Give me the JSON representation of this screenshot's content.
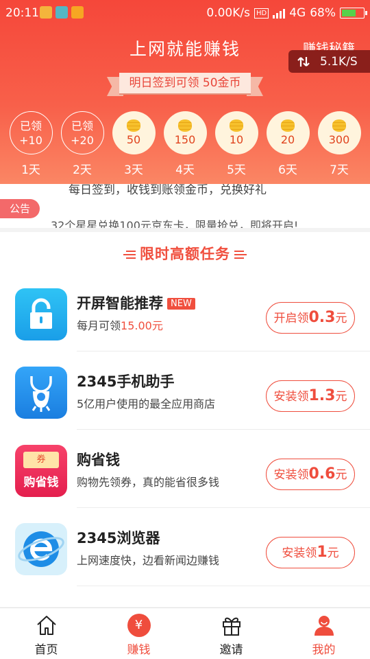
{
  "status_bar": {
    "time": "20:11",
    "network_speed": "0.00K/s",
    "hd": "HD",
    "network_type": "4G",
    "battery": "68%",
    "battery_level": 0.68
  },
  "header": {
    "title": "上网就能赚钱",
    "secret_link": "赚钱秘籍",
    "speed_widget": "5.1K/S"
  },
  "checkin": {
    "banner": "明日签到可领 50金币",
    "days": [
      {
        "state": "done",
        "status": "已领",
        "reward": "+10",
        "label": "1天"
      },
      {
        "state": "done",
        "status": "已领",
        "reward": "+20",
        "label": "2天"
      },
      {
        "state": "todo",
        "reward": "50",
        "label": "3天"
      },
      {
        "state": "todo",
        "reward": "150",
        "label": "4天"
      },
      {
        "state": "todo",
        "reward": "10",
        "label": "5天"
      },
      {
        "state": "todo",
        "reward": "20",
        "label": "6天"
      },
      {
        "state": "todo",
        "reward": "300",
        "label": "7天"
      }
    ]
  },
  "notice": {
    "tag": "公告",
    "text": "32个星星兑换100元京东卡，限量抢兑，即将开启!",
    "previous_text": "每日签到，收钱到账领金币，兑换好礼"
  },
  "tasks": {
    "section_title": "限时高额任务",
    "items": [
      {
        "name": "开屏智能推荐",
        "badge": "NEW",
        "desc_prefix": "每月可领",
        "desc_amount": "15.00元",
        "btn_prefix": "开启领",
        "btn_amount": "0.3",
        "btn_suffix": "元",
        "icon": "lock-icon"
      },
      {
        "name": "2345手机助手",
        "badge": "",
        "desc_prefix": "5亿用户使用的最全应用商店",
        "desc_amount": "",
        "btn_prefix": "安装领",
        "btn_amount": "1.3",
        "btn_suffix": "元",
        "icon": "shopping-bag-icon"
      },
      {
        "name": "购省钱",
        "badge": "",
        "desc_prefix": "购物先领券，真的能省很多钱",
        "desc_amount": "",
        "btn_prefix": "安装领",
        "btn_amount": "0.6",
        "btn_suffix": "元",
        "icon": "coupon-icon",
        "icon_text": "购省钱",
        "icon_ticket": "券"
      },
      {
        "name": "2345浏览器",
        "badge": "",
        "desc_prefix": "上网速度快，边看新闻边赚钱",
        "desc_amount": "",
        "btn_prefix": "安装领",
        "btn_amount": "1",
        "btn_suffix": "元",
        "icon": "browser-icon"
      }
    ]
  },
  "tabbar": {
    "items": [
      {
        "label": "首页",
        "icon": "home-icon"
      },
      {
        "label": "赚钱",
        "icon": "yuan-icon",
        "symbol": "¥"
      },
      {
        "label": "邀请",
        "icon": "gift-icon"
      },
      {
        "label": "我的",
        "icon": "profile-icon"
      }
    ],
    "active_index": 1
  },
  "colors": {
    "accent": "#ef4d3d",
    "header_top": "#f5473a",
    "coin_bg": "#fff4dd",
    "tab_active": "#ef4d3d"
  }
}
